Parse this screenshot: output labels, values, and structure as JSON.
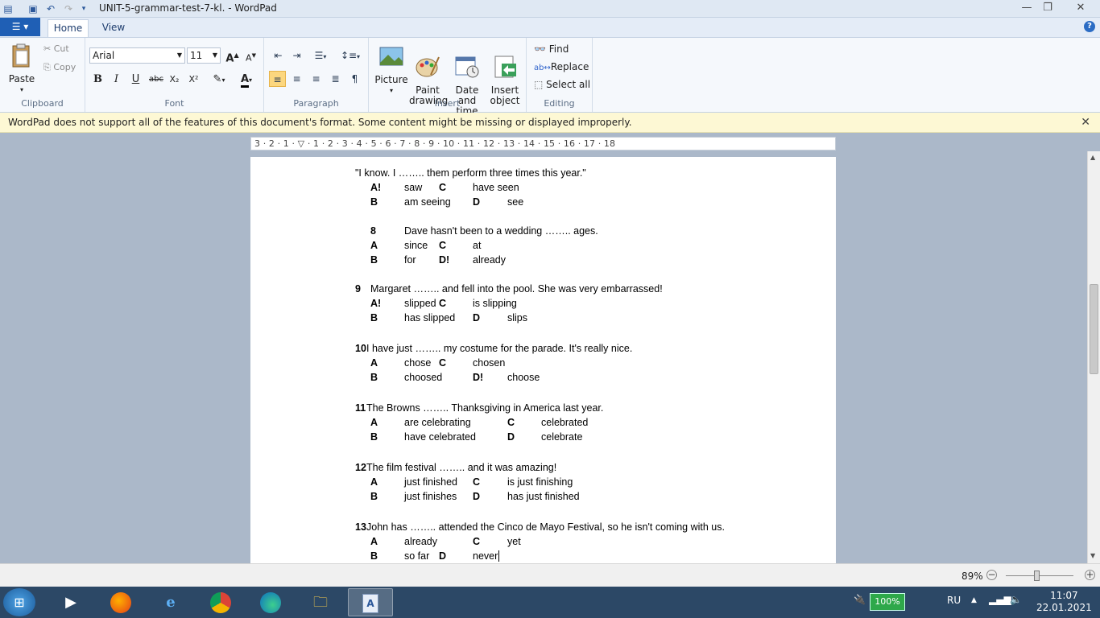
{
  "window": {
    "title": "UNIT-5-grammar-test-7-kl. - WordPad",
    "minimize": "—",
    "maximize": "❐",
    "close": "✕"
  },
  "ribbon": {
    "file_menu": "☰ ▾",
    "tabs": [
      "Home",
      "View"
    ],
    "clipboard": {
      "label": "Clipboard",
      "paste": "Paste",
      "cut": "Cut",
      "copy": "Copy"
    },
    "font": {
      "label": "Font",
      "family": "Arial",
      "size": "11",
      "grow": "A",
      "shrink": "A",
      "bold": "B",
      "italic": "I",
      "underline": "U",
      "strike": "abc",
      "subscript": "X₂",
      "superscript": "X²",
      "color": "A"
    },
    "paragraph": {
      "label": "Paragraph"
    },
    "insert": {
      "label": "Insert",
      "picture": "Picture",
      "paint": "Paint\ndrawing",
      "datetime": "Date and\ntime",
      "object": "Insert\nobject"
    },
    "editing": {
      "label": "Editing",
      "find": "Find",
      "replace": "Replace",
      "select_all": "Select all"
    }
  },
  "infobar": {
    "message": "WordPad does not support all of the features of this document's format. Some content might be missing or displayed improperly.",
    "close": "✕"
  },
  "ruler": {
    "marks": "3 · 2 · 1 · ▽ · 1 · 2 · 3 · 4 · 5 · 6 · 7 · 8 · 9 · 10 · 11 · 12 · 13 · 14 · 15 · 16 · 17 · 18"
  },
  "document": {
    "line0": "\"I know. I …….. them perform three times this year.\"",
    "q7": {
      "a_l": "A!",
      "a": "saw",
      "c_l": "C",
      "c": "have seen",
      "b_l": "B",
      "b": "am seeing",
      "d_l": "D",
      "d": "see"
    },
    "q8": {
      "num": "8",
      "text": "Dave hasn't been to a wedding …….. ages.",
      "a_l": "A",
      "a": "since",
      "c_l": "C",
      "c": "at",
      "b_l": "B",
      "b": "for",
      "d_l": "D!",
      "d": "already"
    },
    "q9": {
      "num": "9",
      "text": "Margaret …….. and fell into the pool. She was very embarrassed!",
      "a_l": "A!",
      "a": "slipped",
      "c_l": "C",
      "c": "is slipping",
      "b_l": "B",
      "b": "has slipped",
      "d_l": "D",
      "d": "slips"
    },
    "q10": {
      "num": "10",
      "text": "I have just …….. my costume for the parade. It's really nice.",
      "a_l": "A",
      "a": "chose",
      "c_l": "C",
      "c": "chosen",
      "b_l": "B",
      "b": "choosed",
      "d_l": "D!",
      "d": "choose"
    },
    "q11": {
      "num": "11",
      "text": "The Browns …….. Thanksgiving in America last year.",
      "a_l": "A",
      "a": "are celebrating",
      "c_l": "C",
      "c": "celebrated",
      "b_l": "B",
      "b": "have celebrated",
      "d_l": "D",
      "d": "celebrate"
    },
    "q12": {
      "num": "12",
      "text": "The film festival …….. and it was amazing!",
      "a_l": "A",
      "a": "just finished",
      "c_l": "C",
      "c": "is just finishing",
      "b_l": "B",
      "b": "just finishes",
      "d_l": "D",
      "d": "has just finished"
    },
    "q13": {
      "num": "13",
      "text": "John has …….. attended the Cinco de Mayo Festival, so he isn't coming with us.",
      "a_l": "A",
      "a": "already",
      "c_l": "C",
      "c": "yet",
      "b_l": "B",
      "b": "so far",
      "d_l": "D",
      "d": "never"
    }
  },
  "status": {
    "zoom": "89%",
    "zoom_out": "−",
    "zoom_in": "+"
  },
  "taskbar": {
    "start": "⊞",
    "battery": "100%",
    "language": "RU",
    "time": "11:07",
    "date": "22.01.2021"
  }
}
